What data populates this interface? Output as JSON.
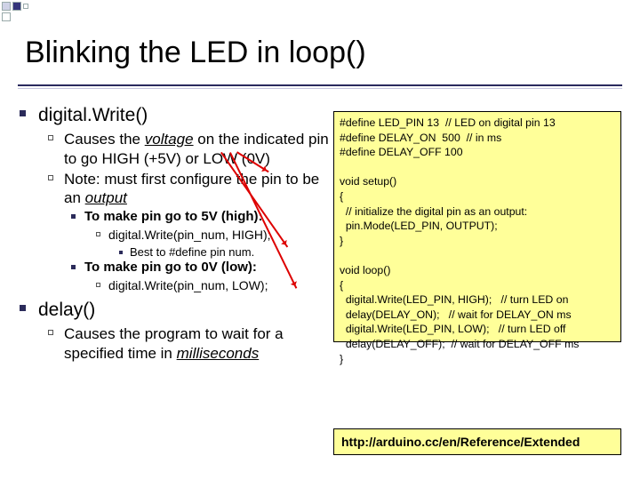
{
  "title": "Blinking the LED in loop()",
  "left": {
    "item1": {
      "heading": "digital.Write()",
      "sub1_pre": "Causes the ",
      "sub1_u": "voltage",
      "sub1_post": " on the indicated pin to go HIGH (+5V) or LOW (0V)",
      "sub2_pre": "Note: must first configure the pin to be an ",
      "sub2_u": "output",
      "s3a": "To make pin go to 5V (high):",
      "s4a": "digital.Write(pin_num, HIGH);",
      "s5a": "Best to #define pin num.",
      "s3b": "To make pin go to 0V (low):",
      "s4b": "digital.Write(pin_num, LOW);"
    },
    "item2": {
      "heading": "delay()",
      "sub1_pre": "Causes the program to wait for a specified time in ",
      "sub1_u": "milliseconds"
    }
  },
  "code": "#define LED_PIN 13  // LED on digital pin 13\n#define DELAY_ON  500  // in ms\n#define DELAY_OFF 100\n\nvoid setup()\n{\n  // initialize the digital pin as an output:\n  pin.Mode(LED_PIN, OUTPUT);\n}\n\nvoid loop()\n{\n  digital.Write(LED_PIN, HIGH);   // turn LED on\n  delay(DELAY_ON);   // wait for DELAY_ON ms\n  digital.Write(LED_PIN, LOW);   // turn LED off\n  delay(DELAY_OFF);  // wait for DELAY_OFF ms\n}",
  "ref": "http://arduino.cc/en/Reference/Extended"
}
